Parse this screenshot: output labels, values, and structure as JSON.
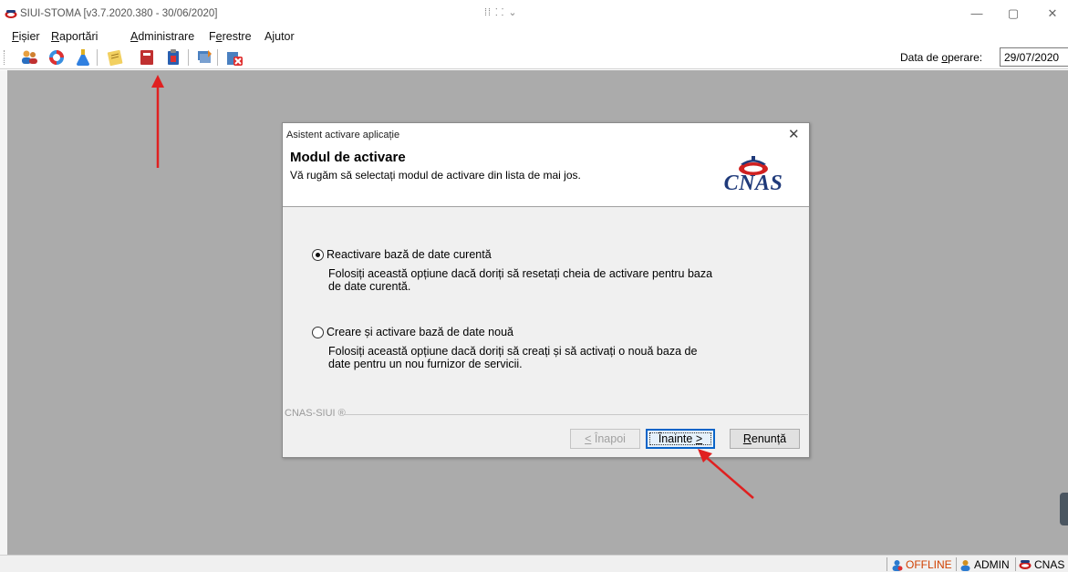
{
  "window": {
    "title": "SIUI-STOMA [v3.7.2020.380 - 30/06/2020]",
    "center_glyphs": "⁞⁞ ⸬ ⌄",
    "minimize": "—",
    "maximize": "▢",
    "close": "✕"
  },
  "menu": {
    "items": [
      {
        "label": "Fișier",
        "key": "F",
        "rest": "ișier"
      },
      {
        "label": "Raportări",
        "key": "R",
        "rest": "aportări"
      },
      {
        "label": "Administrare",
        "key": "A",
        "rest": "dministrare"
      },
      {
        "label": "Ferestre",
        "pre": "F",
        "key": "e",
        "rest": "restre"
      },
      {
        "label": "Ajutor"
      }
    ]
  },
  "toolbar": {
    "date_label_pre": "Data de ",
    "date_label_key": "o",
    "date_label_post": "perare:",
    "date_value": "29/07/2020",
    "icons": [
      "users-icon",
      "lifebuoy-icon",
      "flask-icon",
      "notepad-icon",
      "book-icon",
      "clipboard-icon",
      "stack-icon",
      "exit-icon"
    ]
  },
  "dialog": {
    "title": "Asistent activare aplicație",
    "close": "✕",
    "heading": "Modul de activare",
    "subtitle": "Vă rugăm să selectați modul de activare din lista de mai jos.",
    "logo_text": "CNAS",
    "options": [
      {
        "label": "Reactivare bază de date curentă",
        "description": "Folosiți această opțiune dacă doriți să resetați cheia de activare pentru baza de date curentă.",
        "checked": true
      },
      {
        "label": "Creare și activare bază de date nouă",
        "description": "Folosiți această opțiune dacă doriți să creați și să activați o nouă baza de date pentru un nou furnizor de servicii.",
        "checked": false
      }
    ],
    "footer_label": "CNAS-SIUI ®",
    "buttons": {
      "back_key": "<",
      "back_rest": " Înapoi",
      "next_text": "Înainte ",
      "next_key": ">",
      "cancel_key": "R",
      "cancel_rest": "enunță"
    }
  },
  "status": {
    "offline": "OFFLINE",
    "user": "ADMIN",
    "org": "CNAS"
  },
  "colors": {
    "workspace": "#ababab",
    "offline": "#d04000",
    "accent": "#0a64c8",
    "annotation": "#e02020"
  }
}
